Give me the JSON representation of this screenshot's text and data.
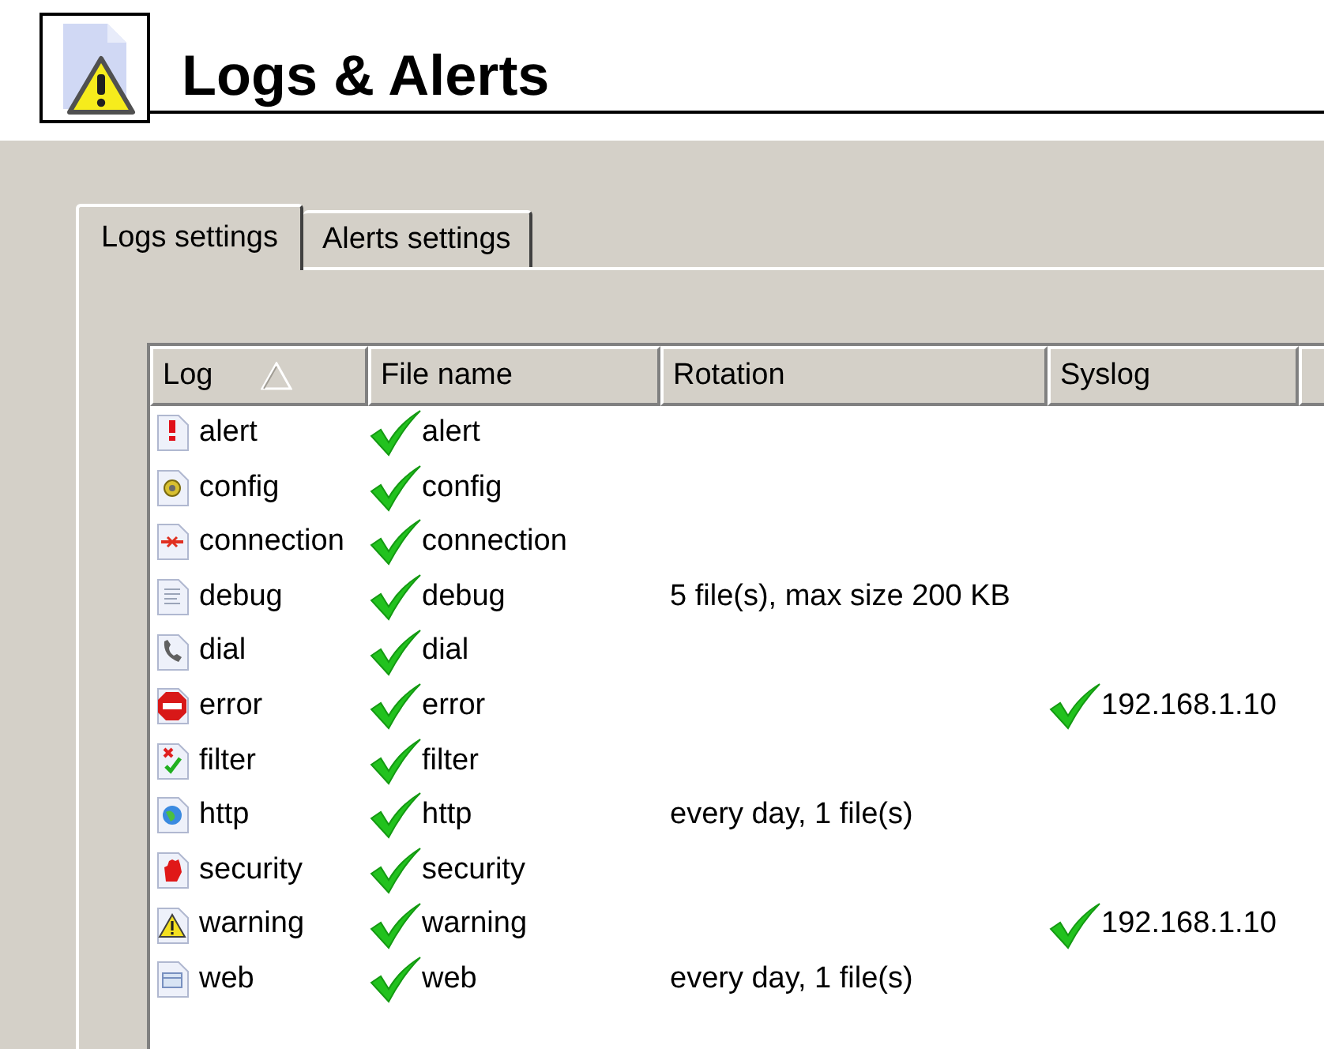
{
  "header": {
    "title": "Logs & Alerts"
  },
  "tabs": [
    {
      "label": "Logs settings",
      "selected": true
    },
    {
      "label": "Alerts settings",
      "selected": false
    }
  ],
  "table": {
    "columns": [
      {
        "label": "Log",
        "sorted": true
      },
      {
        "label": "File name",
        "sorted": false
      },
      {
        "label": "Rotation",
        "sorted": false
      },
      {
        "label": "Syslog",
        "sorted": false
      }
    ],
    "rows": [
      {
        "kind": "alert",
        "log": "alert",
        "file_on": true,
        "file": "alert",
        "syslog_on": false
      },
      {
        "kind": "config",
        "log": "config",
        "file_on": true,
        "file": "config",
        "syslog_on": false
      },
      {
        "kind": "connection",
        "log": "connection",
        "file_on": true,
        "file": "connection",
        "syslog_on": false
      },
      {
        "kind": "debug",
        "log": "debug",
        "file_on": true,
        "file": "debug",
        "rotation": "5 file(s), max size 200 KB",
        "syslog_on": false
      },
      {
        "kind": "dial",
        "log": "dial",
        "file_on": true,
        "file": "dial",
        "syslog_on": false
      },
      {
        "kind": "error",
        "log": "error",
        "file_on": true,
        "file": "error",
        "syslog_on": true,
        "syslog": "192.168.1.10"
      },
      {
        "kind": "filter",
        "log": "filter",
        "file_on": true,
        "file": "filter",
        "syslog_on": false
      },
      {
        "kind": "http",
        "log": "http",
        "file_on": true,
        "file": "http",
        "rotation": "every day, 1 file(s)",
        "syslog_on": false
      },
      {
        "kind": "security",
        "log": "security",
        "file_on": true,
        "file": "security",
        "syslog_on": false
      },
      {
        "kind": "warning",
        "log": "warning",
        "file_on": true,
        "file": "warning",
        "syslog_on": true,
        "syslog": "192.168.1.10"
      },
      {
        "kind": "web",
        "log": "web",
        "file_on": true,
        "file": "web",
        "rotation": "every day, 1 file(s)",
        "syslog_on": false
      }
    ]
  }
}
